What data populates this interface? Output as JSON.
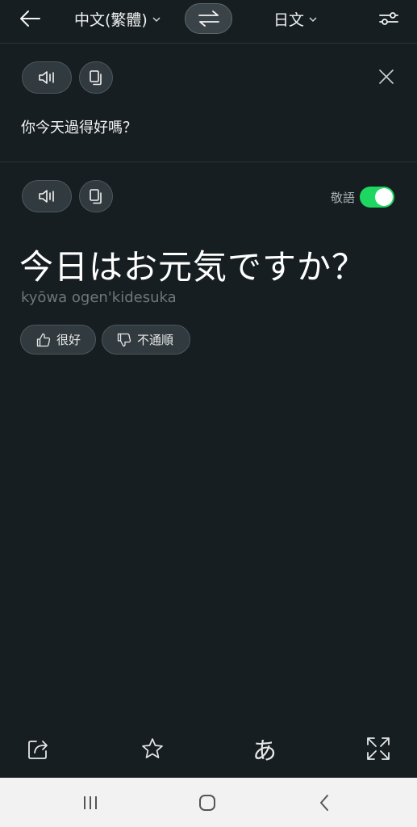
{
  "colors": {
    "background": "#161e21",
    "chip": "#313a3e",
    "toggle_on": "#1ed760",
    "romaji": "#6d777c",
    "navbar": "#f2f2f2"
  },
  "header": {
    "back_icon": "arrow-left-icon",
    "source_language": "中文(繁體)",
    "target_language": "日文",
    "swap_icon": "swap-arrows-icon",
    "settings_icon": "sliders-icon"
  },
  "source": {
    "speak_icon": "speaker-icon",
    "copy_icon": "copy-icon",
    "close_icon": "close-icon",
    "text": "你今天過得好嗎？"
  },
  "target": {
    "speak_icon": "speaker-icon",
    "copy_icon": "copy-icon",
    "honorific_label": "敬語",
    "honorific_on": true,
    "text": "今日はお元気ですか？",
    "romanization": "kyōwa ogen'kidesuka",
    "feedback": {
      "good_label": "很好",
      "bad_label": "不通順"
    }
  },
  "toolbar": {
    "share_icon": "share-icon",
    "favorite_icon": "star-icon",
    "kana_label": "あ",
    "fullscreen_icon": "expand-icon"
  },
  "system_nav": {
    "recents_icon": "recents-icon",
    "home_icon": "home-icon",
    "back_icon": "back-chevron-icon"
  }
}
